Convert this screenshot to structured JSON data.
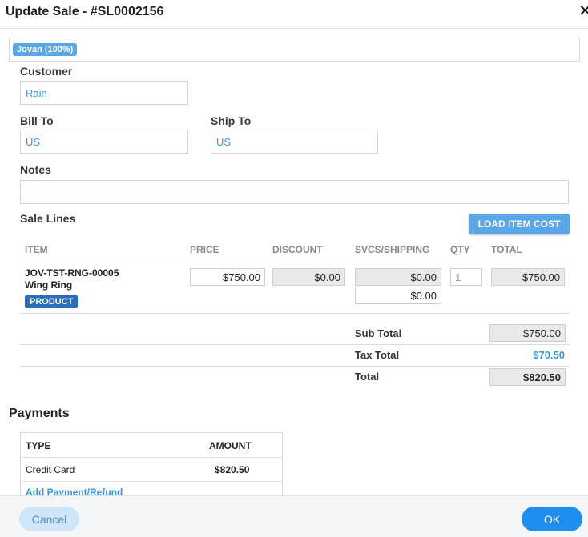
{
  "dialog": {
    "title": "Update Sale - #SL0002156",
    "close_glyph": "✕"
  },
  "assignee": {
    "chip": "Jovan (100%)"
  },
  "customer": {
    "label": "Customer",
    "value": "Rain"
  },
  "bill_to": {
    "label": "Bill To",
    "value": "US"
  },
  "ship_to": {
    "label": "Ship To",
    "value": "US"
  },
  "notes": {
    "label": "Notes",
    "value": ""
  },
  "sale_lines": {
    "label": "Sale Lines",
    "load_button": "LOAD ITEM COST",
    "columns": [
      "ITEM",
      "PRICE",
      "DISCOUNT",
      "SVCS/SHIPPING",
      "QTY",
      "TOTAL"
    ],
    "rows": [
      {
        "sku": "JOV-TST-RNG-00005",
        "name": "Wing Ring",
        "badge": "PRODUCT",
        "price": "$750.00",
        "discount": "$0.00",
        "svcs": "$0.00",
        "shipping": "$0.00",
        "qty": "1",
        "total": "$750.00"
      }
    ]
  },
  "summary": {
    "subtotal_label": "Sub Total",
    "subtotal": "$750.00",
    "tax_label": "Tax Total",
    "tax": "$70.50",
    "total_label": "Total",
    "total": "$820.50"
  },
  "payments": {
    "title": "Payments",
    "col_type": "TYPE",
    "col_amount": "AMOUNT",
    "rows": [
      {
        "type": "Credit Card",
        "amount": "$820.50"
      }
    ],
    "add_link": "Add Payment/Refund"
  },
  "footer": {
    "cancel": "Cancel",
    "ok": "OK"
  },
  "colors": {
    "accent": "#1e8ef0",
    "chip": "#5aa7e8",
    "badge": "#2a6fb5",
    "link": "#3b98e0"
  }
}
